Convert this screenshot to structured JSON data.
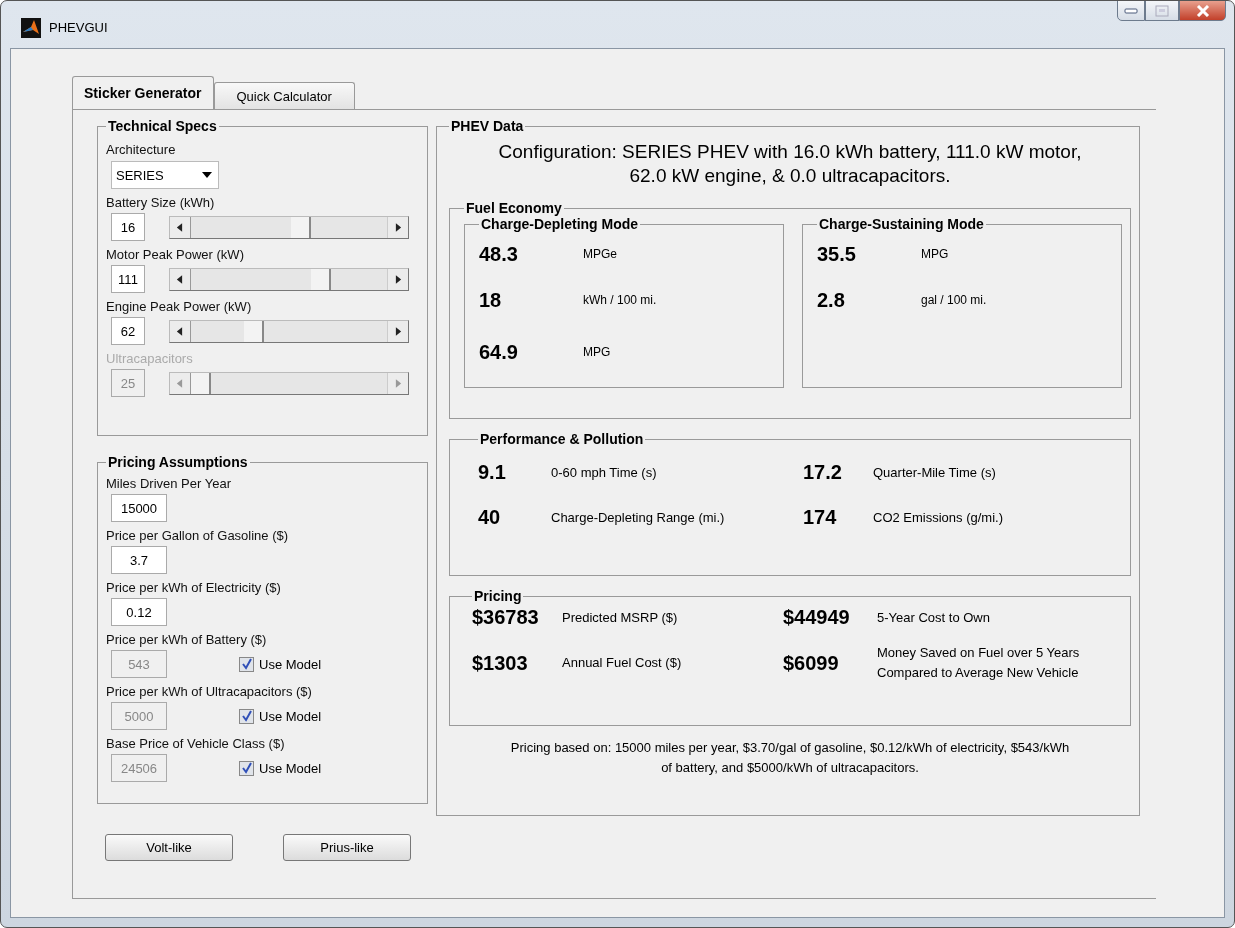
{
  "window": {
    "title": "PHEVGUI"
  },
  "tabs": [
    {
      "label": "Sticker Generator",
      "selected": true
    },
    {
      "label": "Quick Calculator",
      "selected": false
    }
  ],
  "technical_specs": {
    "title": "Technical Specs",
    "architecture": {
      "label": "Architecture",
      "value": "SERIES"
    },
    "sliders": [
      {
        "label": "Battery Size (kWh)",
        "value": "16",
        "level": 0.57,
        "disabled": false
      },
      {
        "label": "Motor Peak Power (kW)",
        "value": "111",
        "level": 0.68,
        "disabled": false
      },
      {
        "label": "Engine Peak Power (kW)",
        "value": "62",
        "level": 0.3,
        "disabled": false
      },
      {
        "label": "Ultracapacitors",
        "value": "25",
        "level": 0,
        "disabled": true
      }
    ]
  },
  "pricing_assumptions": {
    "title": "Pricing Assumptions",
    "fields": [
      {
        "label": "Miles Driven Per Year",
        "value": "15000",
        "disabled": false
      },
      {
        "label": "Price per Gallon of Gasoline ($)",
        "value": "3.7",
        "disabled": false
      },
      {
        "label": "Price per kWh of Electricity ($)",
        "value": "0.12",
        "disabled": false
      },
      {
        "label": "Price per kWh of Battery ($)",
        "value": "543",
        "disabled": true,
        "checkbox": {
          "label": "Use Model",
          "checked": true
        }
      },
      {
        "label": "Price per kWh of Ultracapacitors ($)",
        "value": "5000",
        "disabled": true,
        "checkbox": {
          "label": "Use Model",
          "checked": true
        }
      },
      {
        "label": "Base Price of Vehicle Class ($)",
        "value": "24506",
        "disabled": true,
        "checkbox": {
          "label": "Use Model",
          "checked": true
        }
      }
    ]
  },
  "buttons": [
    "Volt-like",
    "Prius-like"
  ],
  "phev_data": {
    "title": "PHEV Data",
    "configuration": "Configuration: SERIES PHEV with 16.0 kWh battery, 111.0 kW motor, 62.0 kW engine, & 0.0 ultracapacitors.",
    "fuel_economy": {
      "title": "Fuel Economy",
      "modes": [
        {
          "title": "Charge-Depleting Mode",
          "metrics": [
            {
              "value": "48.3",
              "unit": "MPGe"
            },
            {
              "value": "18",
              "unit": "kWh / 100 mi."
            },
            {
              "value": "64.9",
              "unit": "MPG"
            }
          ]
        },
        {
          "title": "Charge-Sustaining Mode",
          "metrics": [
            {
              "value": "35.5",
              "unit": "MPG"
            },
            {
              "value": "2.8",
              "unit": "gal / 100 mi."
            }
          ]
        }
      ]
    },
    "performance": {
      "title": "Performance & Pollution",
      "metrics": [
        {
          "value": "9.1",
          "label": "0-60 mph Time (s)"
        },
        {
          "value": "17.2",
          "label": "Quarter-Mile Time (s)"
        },
        {
          "value": "40",
          "label": "Charge-Depleting Range (mi.)"
        },
        {
          "value": "174",
          "label": "CO2 Emissions (g/mi.)"
        }
      ]
    },
    "pricing": {
      "title": "Pricing",
      "metrics": [
        {
          "value": "$36783",
          "label": "Predicted MSRP ($)"
        },
        {
          "value": "$44949",
          "label": "5-Year Cost to Own"
        },
        {
          "value": "$1303",
          "label": "Annual Fuel Cost ($)"
        },
        {
          "value": "$6099",
          "label": "Money Saved on Fuel over 5 Years Compared to Average New Vehicle"
        }
      ]
    },
    "note": "Pricing based on: 15000 miles per year, $3.70/gal of gasoline, $0.12/kWh of electricity, $543/kWh of battery, and $5000/kWh of ultracapacitors."
  }
}
